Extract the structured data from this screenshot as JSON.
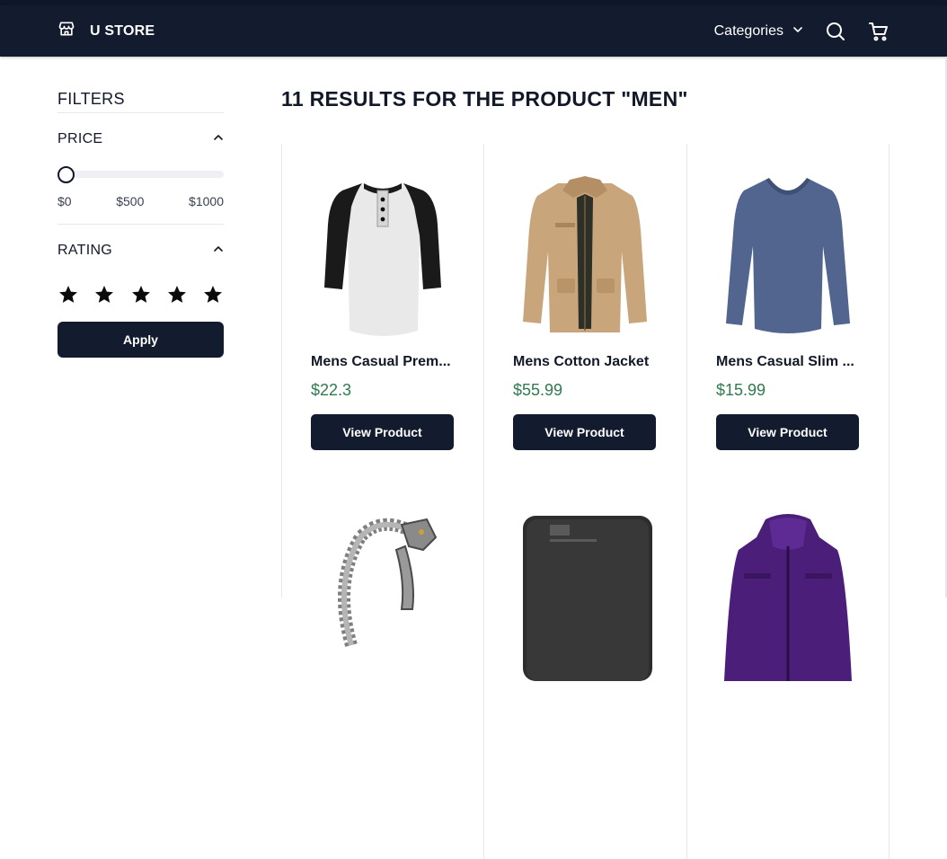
{
  "header": {
    "brand": "U STORE",
    "categories_label": "Categories"
  },
  "sidebar": {
    "title": "FILTERS",
    "price": {
      "label": "PRICE",
      "min_label": "$0",
      "mid_label": "$500",
      "max_label": "$1000",
      "slider_value": 0
    },
    "rating": {
      "label": "RATING",
      "stars": 5
    },
    "apply_label": "Apply"
  },
  "results": {
    "title": "11 RESULTS FOR THE PRODUCT \"MEN\""
  },
  "products": [
    {
      "name": "Mens Casual Prem...",
      "price": "$22.3",
      "button": "View Product",
      "image_icon": "raglan-henley-shirt"
    },
    {
      "name": "Mens Cotton Jacket",
      "price": "$55.99",
      "button": "View Product",
      "image_icon": "cotton-jacket"
    },
    {
      "name": "Mens Casual Slim ...",
      "price": "$15.99",
      "button": "View Product",
      "image_icon": "slim-tshirt"
    },
    {
      "image_icon": "dragon-bracelet"
    },
    {
      "image_icon": "external-hard-drive"
    },
    {
      "image_icon": "purple-jacket"
    }
  ],
  "colors": {
    "nav_bg": "#131b2e",
    "price_green": "#2f7a4e",
    "button_bg": "#131b2e"
  }
}
